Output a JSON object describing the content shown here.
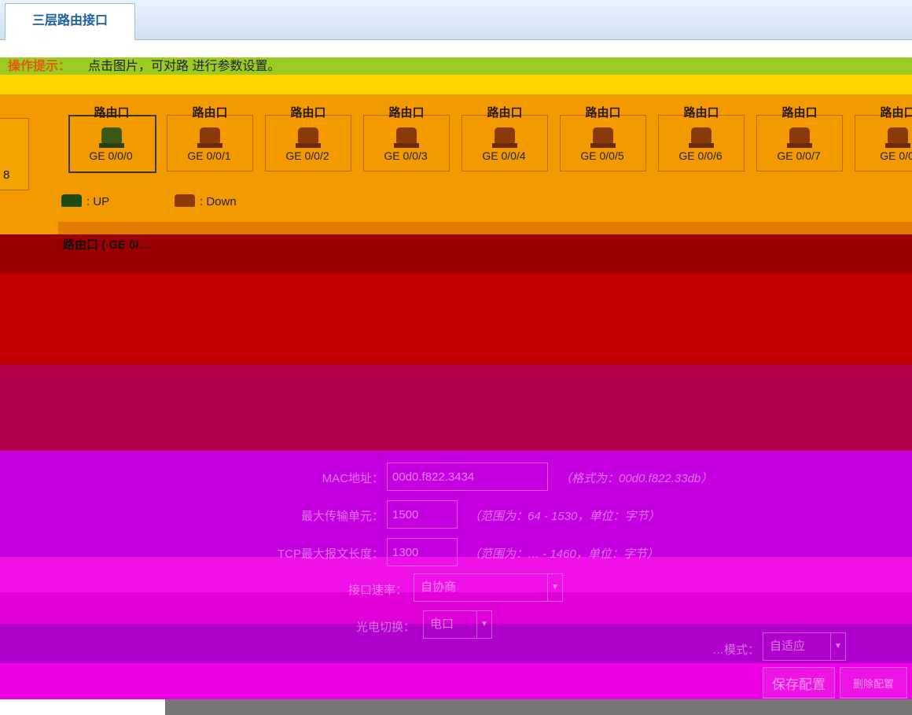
{
  "tab": {
    "title": "三层路由接口"
  },
  "hint": {
    "label": "操作提示：",
    "message": "点击图片，可对路 进行参数设置。"
  },
  "left_card": {
    "text": "8"
  },
  "ports": [
    {
      "title": "路由口",
      "label": "GE 0/0/0",
      "selected": true
    },
    {
      "title": "路由口",
      "label": "GE 0/0/1",
      "selected": false
    },
    {
      "title": "路由口",
      "label": "GE 0/0/2",
      "selected": false
    },
    {
      "title": "路由口",
      "label": "GE 0/0/3",
      "selected": false
    },
    {
      "title": "路由口",
      "label": "GE 0/0/4",
      "selected": false
    },
    {
      "title": "路由口",
      "label": "GE 0/0/5",
      "selected": false
    },
    {
      "title": "路由口",
      "label": "GE 0/0/6",
      "selected": false
    },
    {
      "title": "路由口",
      "label": "GE 0/0/7",
      "selected": false
    },
    {
      "title": "路由口",
      "label": "GE 0/0",
      "selected": false
    }
  ],
  "legend": {
    "up": ": UP",
    "down": ": Down"
  },
  "section": {
    "title": "路由口 ( GE 0/…"
  },
  "form": {
    "mac_label": "MAC地址：",
    "mac_value": "00d0.f822.3434",
    "mac_hint": "（格式为：00d0.f822.33db）",
    "mtu_label": "最大传输单元：",
    "mtu_value": "1500",
    "mtu_hint": "（范围为：64 - 1530，单位：字节）",
    "mss_label": "TCP最大报文长度：",
    "mss_value": "1300",
    "mss_hint": "（范围为：… - 1460，单位：字节）",
    "speed_label": "接口速率：",
    "speed_value": "自协商",
    "media_label": "光电切换：",
    "media_value": "电口",
    "mode_label": "…模式：",
    "mode_value": "自适应"
  },
  "buttons": {
    "save": "保存配置",
    "delete": "删除配置"
  }
}
